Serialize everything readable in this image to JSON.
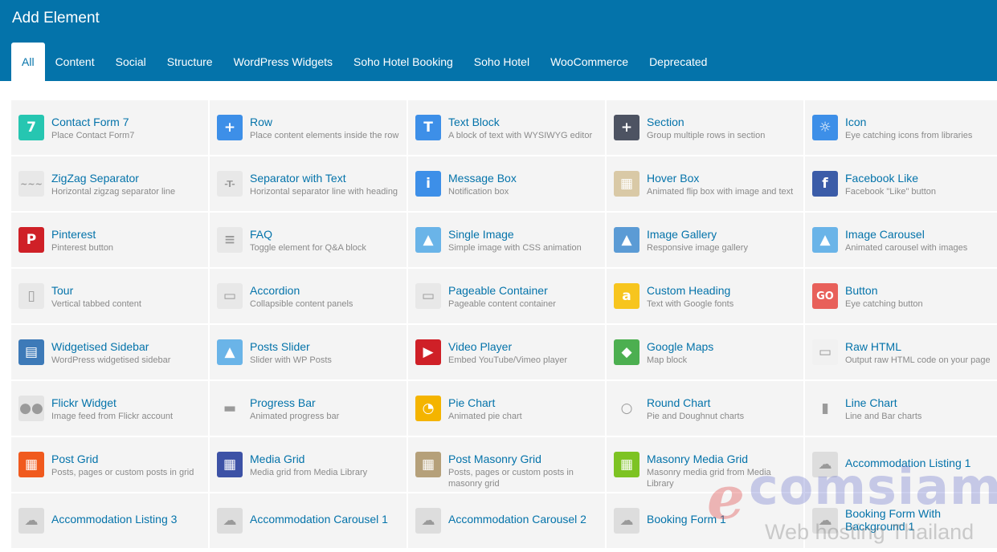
{
  "header": {
    "title": "Add Element"
  },
  "tabs": [
    {
      "label": "All",
      "active": true
    },
    {
      "label": "Content"
    },
    {
      "label": "Social"
    },
    {
      "label": "Structure"
    },
    {
      "label": "WordPress Widgets"
    },
    {
      "label": "Soho Hotel Booking"
    },
    {
      "label": "Soho Hotel"
    },
    {
      "label": "WooCommerce"
    },
    {
      "label": "Deprecated"
    }
  ],
  "elements": [
    {
      "name": "Contact Form 7",
      "desc": "Place Contact Form7",
      "icon": "contact-form-icon",
      "color": "#26c6b1",
      "glyph": "7"
    },
    {
      "name": "Row",
      "desc": "Place content elements inside the row",
      "icon": "row-icon",
      "color": "#3d8fe8",
      "glyph": "+"
    },
    {
      "name": "Text Block",
      "desc": "A block of text with WYSIWYG editor",
      "icon": "text-block-icon",
      "color": "#3d8fe8",
      "glyph": "T"
    },
    {
      "name": "Section",
      "desc": "Group multiple rows in section",
      "icon": "section-icon",
      "color": "#4d5362",
      "glyph": "+"
    },
    {
      "name": "Icon",
      "desc": "Eye catching icons from libraries",
      "icon": "icon-icon",
      "color": "#3d8fe8",
      "glyph": "☼"
    },
    {
      "name": "ZigZag Separator",
      "desc": "Horizontal zigzag separator line",
      "icon": "zigzag-separator-icon",
      "color": "#e8e8e8",
      "glyph": "~~~"
    },
    {
      "name": "Separator with Text",
      "desc": "Horizontal separator line with heading",
      "icon": "separator-text-icon",
      "color": "#e8e8e8",
      "glyph": "-T-"
    },
    {
      "name": "Message Box",
      "desc": "Notification box",
      "icon": "message-box-icon",
      "color": "#3d8fe8",
      "glyph": "i"
    },
    {
      "name": "Hover Box",
      "desc": "Animated flip box with image and text",
      "icon": "hover-box-icon",
      "color": "#d9c9a6",
      "glyph": "▦"
    },
    {
      "name": "Facebook Like",
      "desc": "Facebook \"Like\" button",
      "icon": "facebook-icon",
      "color": "#3b5ca8",
      "glyph": "f"
    },
    {
      "name": "Pinterest",
      "desc": "Pinterest button",
      "icon": "pinterest-icon",
      "color": "#cf2027",
      "glyph": "P"
    },
    {
      "name": "FAQ",
      "desc": "Toggle element for Q&A block",
      "icon": "faq-icon",
      "color": "#e8e8e8",
      "glyph": "≡"
    },
    {
      "name": "Single Image",
      "desc": "Simple image with CSS animation",
      "icon": "single-image-icon",
      "color": "#6ab4e8",
      "glyph": "▲"
    },
    {
      "name": "Image Gallery",
      "desc": "Responsive image gallery",
      "icon": "image-gallery-icon",
      "color": "#5b9bd5",
      "glyph": "▲"
    },
    {
      "name": "Image Carousel",
      "desc": "Animated carousel with images",
      "icon": "image-carousel-icon",
      "color": "#6ab4e8",
      "glyph": "▲"
    },
    {
      "name": "Tour",
      "desc": "Vertical tabbed content",
      "icon": "tour-icon",
      "color": "#e8e8e8",
      "glyph": "▯"
    },
    {
      "name": "Accordion",
      "desc": "Collapsible content panels",
      "icon": "accordion-icon",
      "color": "#e8e8e8",
      "glyph": "▭"
    },
    {
      "name": "Pageable Container",
      "desc": "Pageable content container",
      "icon": "pageable-container-icon",
      "color": "#e8e8e8",
      "glyph": "▭"
    },
    {
      "name": "Custom Heading",
      "desc": "Text with Google fonts",
      "icon": "custom-heading-icon",
      "color": "#f7c51e",
      "glyph": "a"
    },
    {
      "name": "Button",
      "desc": "Eye catching button",
      "icon": "button-icon",
      "color": "#e8605a",
      "glyph": "GO"
    },
    {
      "name": "Widgetised Sidebar",
      "desc": "WordPress widgetised sidebar",
      "icon": "widgetised-sidebar-icon",
      "color": "#3d7ab8",
      "glyph": "▤"
    },
    {
      "name": "Posts Slider",
      "desc": "Slider with WP Posts",
      "icon": "posts-slider-icon",
      "color": "#6ab4e8",
      "glyph": "▲"
    },
    {
      "name": "Video Player",
      "desc": "Embed YouTube/Vimeo player",
      "icon": "video-player-icon",
      "color": "#cf2027",
      "glyph": "▶"
    },
    {
      "name": "Google Maps",
      "desc": "Map block",
      "icon": "google-maps-icon",
      "color": "#4caf50",
      "glyph": "◆"
    },
    {
      "name": "Raw HTML",
      "desc": "Output raw HTML code on your page",
      "icon": "raw-html-icon",
      "color": "#f1f1f1",
      "glyph": "▭"
    },
    {
      "name": "Flickr Widget",
      "desc": "Image feed from Flickr account",
      "icon": "flickr-icon",
      "color": "#e4e4e4",
      "glyph": "●●"
    },
    {
      "name": "Progress Bar",
      "desc": "Animated progress bar",
      "icon": "progress-bar-icon",
      "color": "#f4f4f4",
      "glyph": "▬"
    },
    {
      "name": "Pie Chart",
      "desc": "Animated pie chart",
      "icon": "pie-chart-icon",
      "color": "#f4b400",
      "glyph": "◔"
    },
    {
      "name": "Round Chart",
      "desc": "Pie and Doughnut charts",
      "icon": "round-chart-icon",
      "color": "#f4f4f4",
      "glyph": "○"
    },
    {
      "name": "Line Chart",
      "desc": "Line and Bar charts",
      "icon": "line-chart-icon",
      "color": "#f4f4f4",
      "glyph": "▮"
    },
    {
      "name": "Post Grid",
      "desc": "Posts, pages or custom posts in grid",
      "icon": "post-grid-icon",
      "color": "#f05a1e",
      "glyph": "▦"
    },
    {
      "name": "Media Grid",
      "desc": "Media grid from Media Library",
      "icon": "media-grid-icon",
      "color": "#3d52a6",
      "glyph": "▦"
    },
    {
      "name": "Post Masonry Grid",
      "desc": "Posts, pages or custom posts in masonry grid",
      "icon": "post-masonry-grid-icon",
      "color": "#b5a07a",
      "glyph": "▦"
    },
    {
      "name": "Masonry Media Grid",
      "desc": "Masonry media grid from Media Library",
      "icon": "masonry-media-grid-icon",
      "color": "#7dc323",
      "glyph": "▦"
    },
    {
      "name": "Accommodation Listing 1",
      "desc": "",
      "icon": "cloud-icon",
      "color": "#dddddd",
      "glyph": "☁"
    },
    {
      "name": "Accommodation Listing 3",
      "desc": "",
      "icon": "cloud-icon",
      "color": "#dddddd",
      "glyph": "☁"
    },
    {
      "name": "Accommodation Carousel 1",
      "desc": "",
      "icon": "cloud-icon",
      "color": "#dddddd",
      "glyph": "☁"
    },
    {
      "name": "Accommodation Carousel 2",
      "desc": "",
      "icon": "cloud-icon",
      "color": "#dddddd",
      "glyph": "☁"
    },
    {
      "name": "Booking Form 1",
      "desc": "",
      "icon": "cloud-icon",
      "color": "#dddddd",
      "glyph": "☁"
    },
    {
      "name": "Booking Form With Background 1",
      "desc": "",
      "icon": "cloud-icon",
      "color": "#dddddd",
      "glyph": "☁"
    }
  ],
  "watermark": {
    "brand": "ecomsiam",
    "tagline": "Web hosting Thailand"
  }
}
